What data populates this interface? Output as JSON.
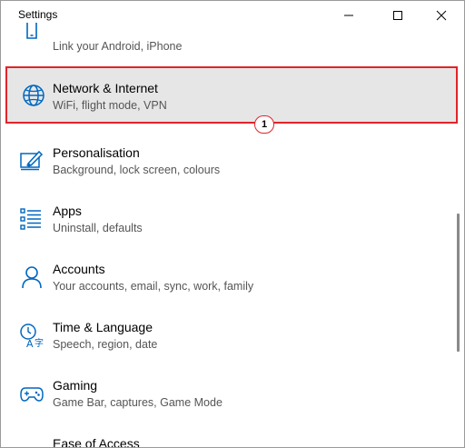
{
  "window": {
    "title": "Settings"
  },
  "items": [
    {
      "label": "",
      "desc": "Link your Android, iPhone"
    },
    {
      "label": "Network & Internet",
      "desc": "WiFi, flight mode, VPN"
    },
    {
      "label": "Personalisation",
      "desc": "Background, lock screen, colours"
    },
    {
      "label": "Apps",
      "desc": "Uninstall, defaults"
    },
    {
      "label": "Accounts",
      "desc": "Your accounts, email, sync, work, family"
    },
    {
      "label": "Time & Language",
      "desc": "Speech, region, date"
    },
    {
      "label": "Gaming",
      "desc": "Game Bar, captures, Game Mode"
    },
    {
      "label": "Ease of Access",
      "desc": ""
    }
  ],
  "annotation": {
    "callout_number": "1"
  },
  "colors": {
    "accent": "#0067c0",
    "highlight_border": "#e0242a",
    "highlight_bg": "#e6e6e6"
  }
}
